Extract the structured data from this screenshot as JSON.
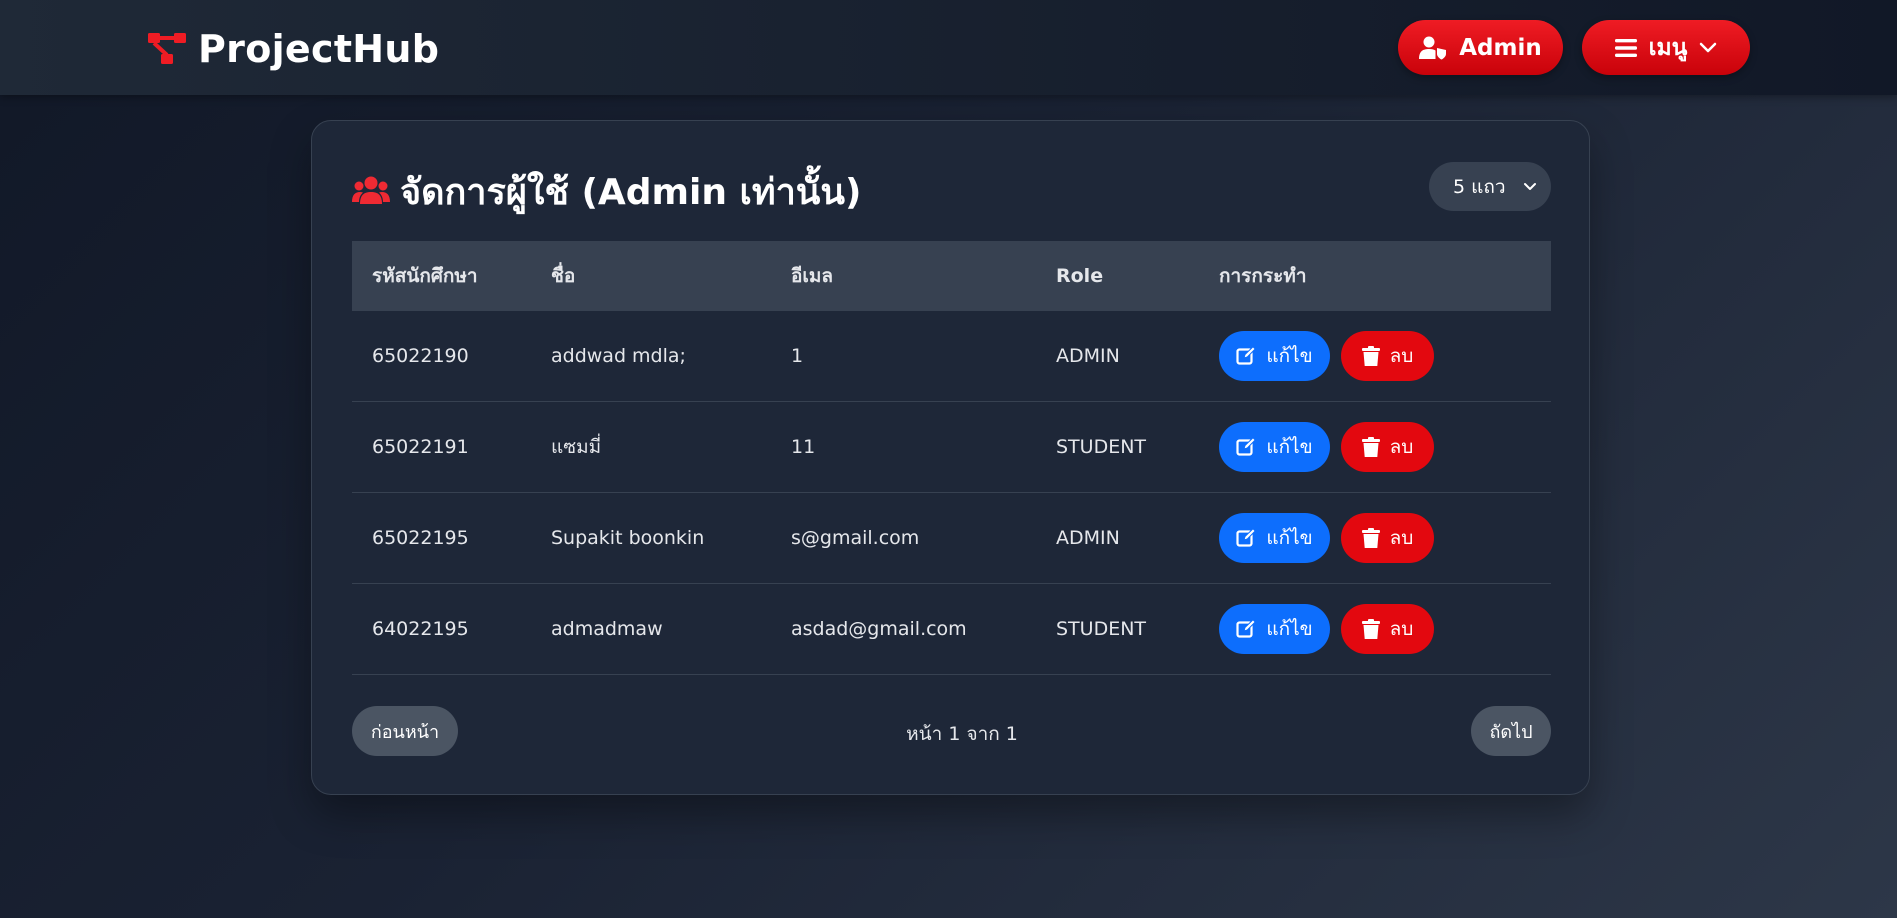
{
  "brand": {
    "name": "ProjectHub",
    "icon": "project-diagram-icon"
  },
  "nav": {
    "admin_label": "Admin",
    "menu_label": "เมนู"
  },
  "card": {
    "title": "จัดการผู้ใช้ (Admin เท่านั้น)",
    "title_icon": "users-icon",
    "rows_per_page": "5 แถว"
  },
  "table": {
    "headers": [
      "รหัสนักศึกษา",
      "ชื่อ",
      "อีเมล",
      "Role",
      "การกระทำ"
    ],
    "rows": [
      {
        "id": "65022190",
        "name": "addwad mdla;",
        "email": "1",
        "role": "ADMIN"
      },
      {
        "id": "65022191",
        "name": "แซมมี่",
        "email": "11",
        "role": "STUDENT"
      },
      {
        "id": "65022195",
        "name": "Supakit boonkin",
        "email": "s@gmail.com",
        "role": "ADMIN"
      },
      {
        "id": "64022195",
        "name": "admadmaw",
        "email": "asdad@gmail.com",
        "role": "STUDENT"
      }
    ],
    "edit_label": "แก้ไข",
    "delete_label": "ลบ"
  },
  "pagination": {
    "prev_label": "ก่อนหน้า",
    "next_label": "ถัดไป",
    "page_info": "หน้า 1 จาก 1"
  },
  "colors": {
    "accent_red": "#e3080f",
    "edit_blue": "#0d6efd",
    "card_bg": "#1e2738",
    "header_bg": "#374151"
  }
}
